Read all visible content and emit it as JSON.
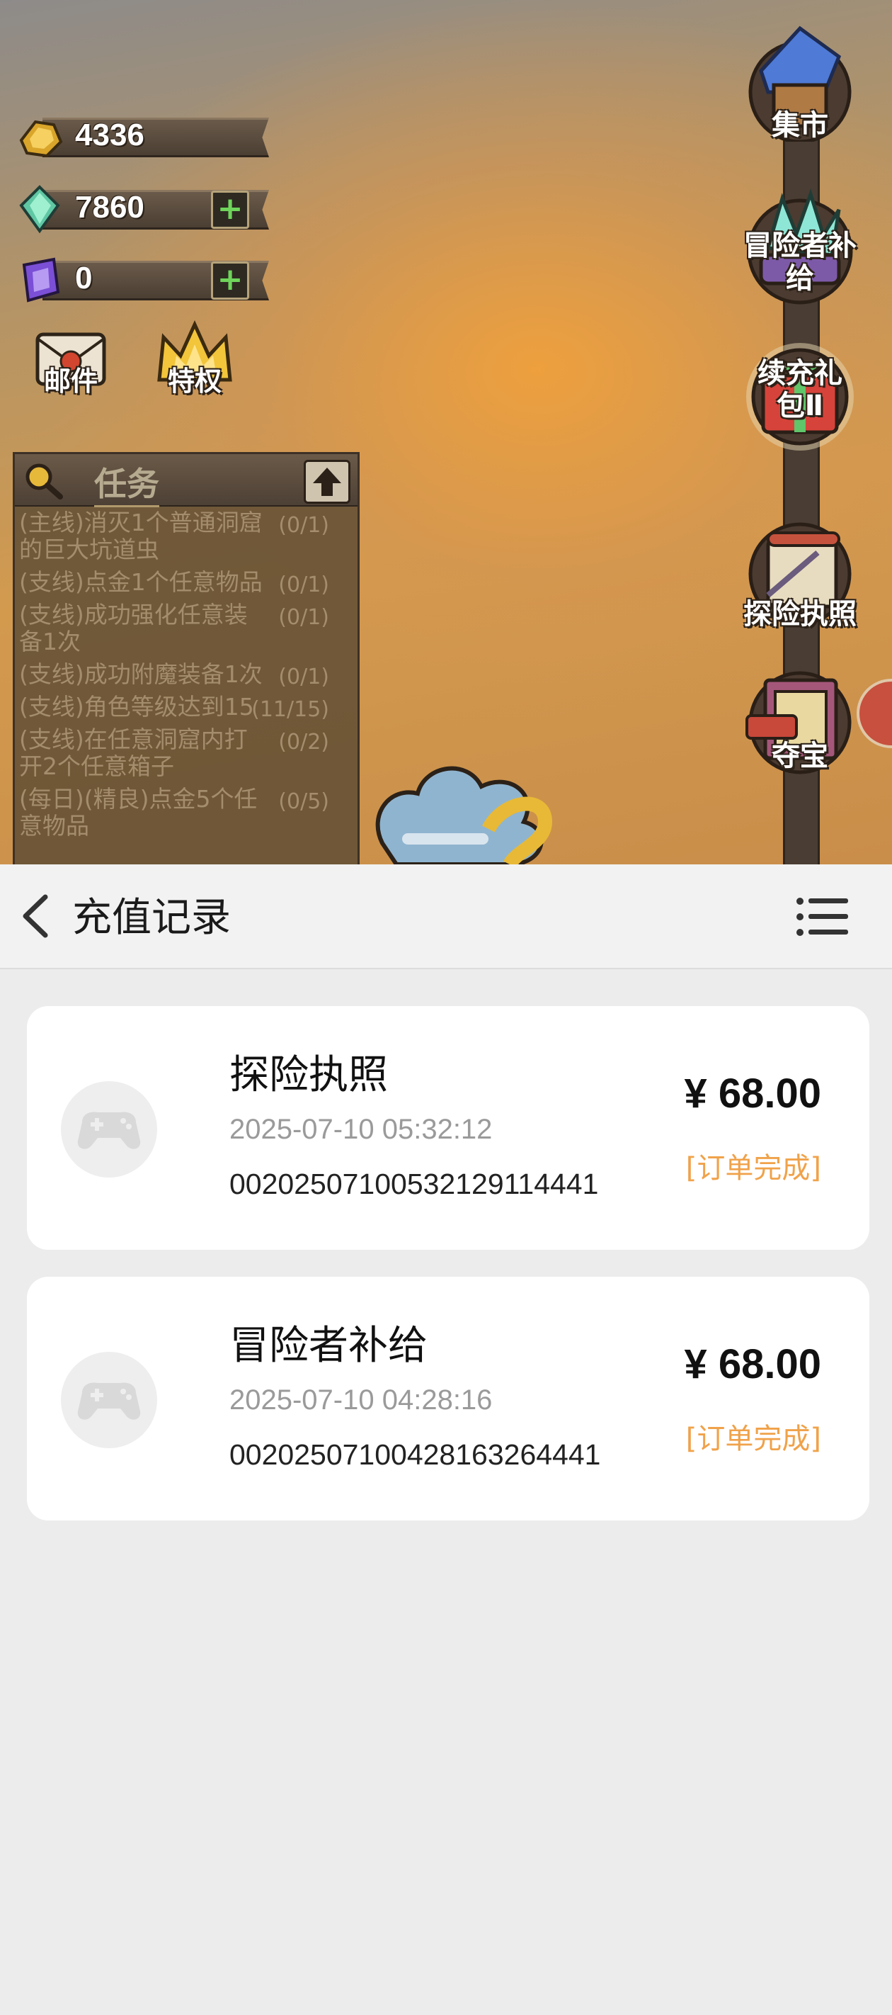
{
  "game": {
    "resources": [
      {
        "icon": "gold-icon",
        "value": "4336",
        "has_plus": false
      },
      {
        "icon": "crystal-icon",
        "value": "7860",
        "has_plus": true
      },
      {
        "icon": "purple-gem-icon",
        "value": "0",
        "has_plus": true
      }
    ],
    "mail_label": "邮件",
    "privilege_label": "特权",
    "quest": {
      "title": "任务",
      "items": [
        {
          "text": "(主线)消灭1个普通洞窟的巨大坑道虫",
          "count": "(0/1)"
        },
        {
          "text": "(支线)点金1个任意物品",
          "count": "(0/1)"
        },
        {
          "text": "(支线)成功强化任意装备1次",
          "count": "(0/1)"
        },
        {
          "text": "(支线)成功附魔装备1次",
          "count": "(0/1)"
        },
        {
          "text": "(支线)角色等级达到15",
          "count": "(11/15)"
        },
        {
          "text": "(支线)在任意洞窟内打开2个任意箱子",
          "count": "(0/2)"
        },
        {
          "text": "(每日)(精良)点金5个任意物品",
          "count": "(0/5)"
        }
      ]
    },
    "side_buttons": [
      {
        "label": "集市"
      },
      {
        "label": "冒险者补给"
      },
      {
        "label": "续充礼包Ⅱ"
      },
      {
        "label": "探险执照"
      },
      {
        "label": "夺宝"
      }
    ]
  },
  "app": {
    "title": "充值记录",
    "records": [
      {
        "name": "探险执照",
        "time": "2025-07-10 05:32:12",
        "order_id": "00202507100532129114441",
        "price": "¥ 68.00",
        "status": "[订单完成]"
      },
      {
        "name": "冒险者补给",
        "time": "2025-07-10 04:28:16",
        "order_id": "00202507100428163264441",
        "price": "¥ 68.00",
        "status": "[订单完成]"
      }
    ]
  },
  "colors": {
    "status_orange": "#f0a24a",
    "card_bg": "#ffffff",
    "page_bg": "#ececec"
  }
}
